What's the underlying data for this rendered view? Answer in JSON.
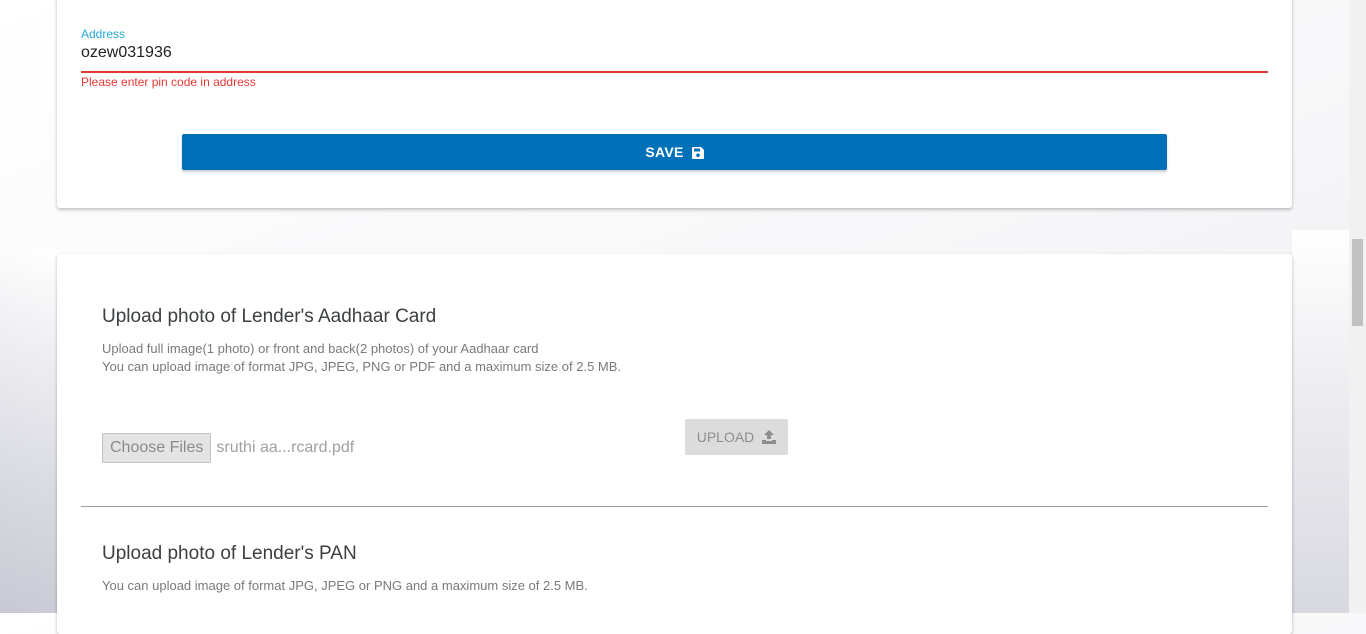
{
  "address_field": {
    "label": "Address",
    "value": "ozew031936",
    "error": "Please enter pin code in address"
  },
  "save_button": {
    "label": "SAVE",
    "icon": "floppy-disk-icon"
  },
  "aadhaar_section": {
    "title": "Upload photo of Lender's Aadhaar Card",
    "desc_line1": "Upload full image(1 photo) or front and back(2 photos) of your Aadhaar card",
    "desc_line2": "You can upload image of format JPG, JPEG, PNG or PDF and a maximum size of 2.5 MB.",
    "choose_label": "Choose Files",
    "file_name": "sruthi aa...rcard.pdf",
    "upload_label": "UPLOAD",
    "upload_icon": "upload-icon"
  },
  "pan_section": {
    "title": "Upload photo of Lender's PAN",
    "desc": "You can upload image of format JPG, JPEG or PNG and a maximum size of 2.5 MB."
  },
  "colors": {
    "primary": "#0070b8",
    "error": "#e53935",
    "label_accent": "#26a9d8"
  }
}
